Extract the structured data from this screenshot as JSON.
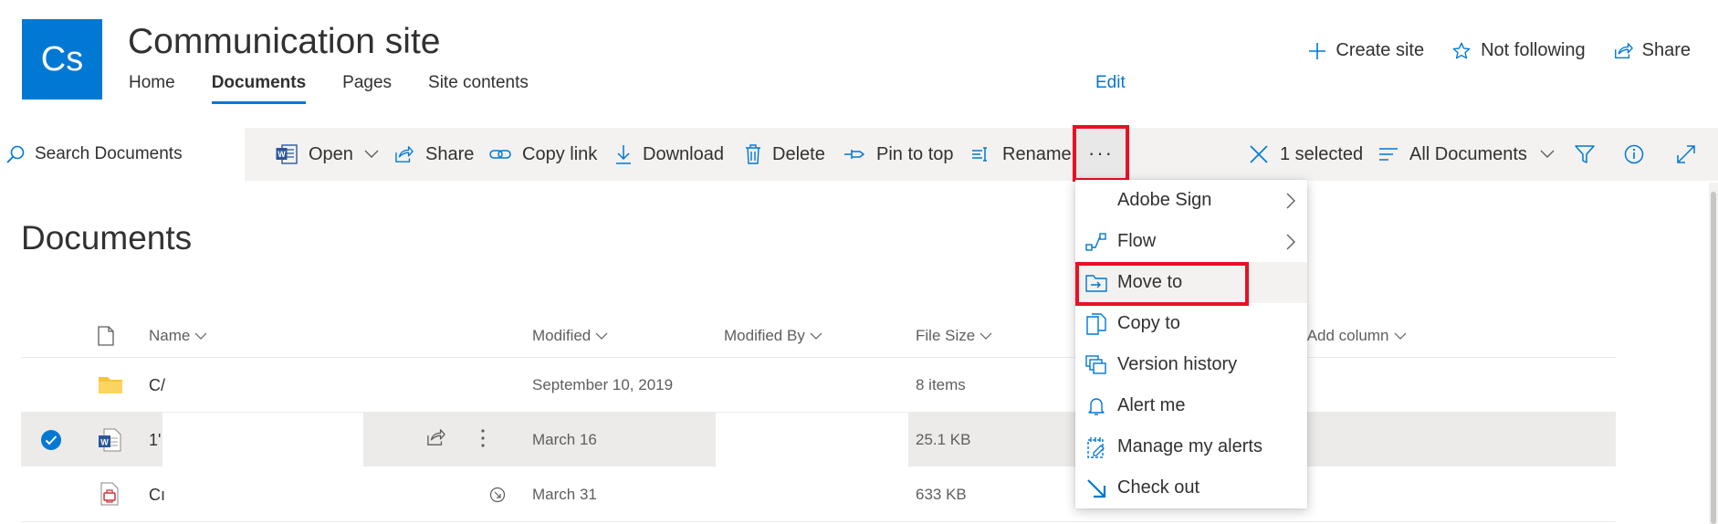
{
  "site": {
    "logo_text": "Cs",
    "title": "Communication site",
    "nav": [
      "Home",
      "Documents",
      "Pages",
      "Site contents"
    ],
    "edit_label": "Edit",
    "actions": {
      "create_site": "Create site",
      "follow": "Not following",
      "share": "Share"
    }
  },
  "commandbar": {
    "search_placeholder": "Search Documents",
    "open": "Open",
    "share": "Share",
    "copy_link": "Copy link",
    "download": "Download",
    "delete": "Delete",
    "pin_to_top": "Pin to top",
    "rename": "Rename",
    "more": "···",
    "selected": "1 selected",
    "view": "All Documents"
  },
  "library": {
    "heading": "Documents",
    "columns": {
      "name": "Name",
      "modified": "Modified",
      "modified_by": "Modified By",
      "file_size": "File Size",
      "add_column": "+ Add column"
    },
    "rows": [
      {
        "name": "C/",
        "modified": "September 10, 2019",
        "size": "8 items",
        "type": "folder",
        "selected": false
      },
      {
        "name": "1'",
        "modified": "March 16",
        "size": "25.1 KB",
        "type": "word",
        "selected": true
      },
      {
        "name": "Cı",
        "modified": "March 31",
        "size": "633 KB",
        "type": "pdf",
        "selected": false
      }
    ]
  },
  "menu": {
    "items": [
      {
        "label": "Adobe Sign",
        "icon": "none",
        "submenu": true
      },
      {
        "label": "Flow",
        "icon": "flow-icon",
        "submenu": true
      },
      {
        "label": "Move to",
        "icon": "move-to-icon",
        "submenu": false
      },
      {
        "label": "Copy to",
        "icon": "copy-icon",
        "submenu": false
      },
      {
        "label": "Version history",
        "icon": "version-history-icon",
        "submenu": false
      },
      {
        "label": "Alert me",
        "icon": "bell-icon",
        "submenu": false
      },
      {
        "label": "Manage my alerts",
        "icon": "manage-alerts-icon",
        "submenu": false
      },
      {
        "label": "Check out",
        "icon": "check-out-icon",
        "submenu": false
      }
    ]
  },
  "colors": {
    "accent": "#0078d4",
    "highlight_frame": "#e81123",
    "folder": "#f8c33c",
    "word": "#2b579a",
    "pdf": "#d13438"
  }
}
